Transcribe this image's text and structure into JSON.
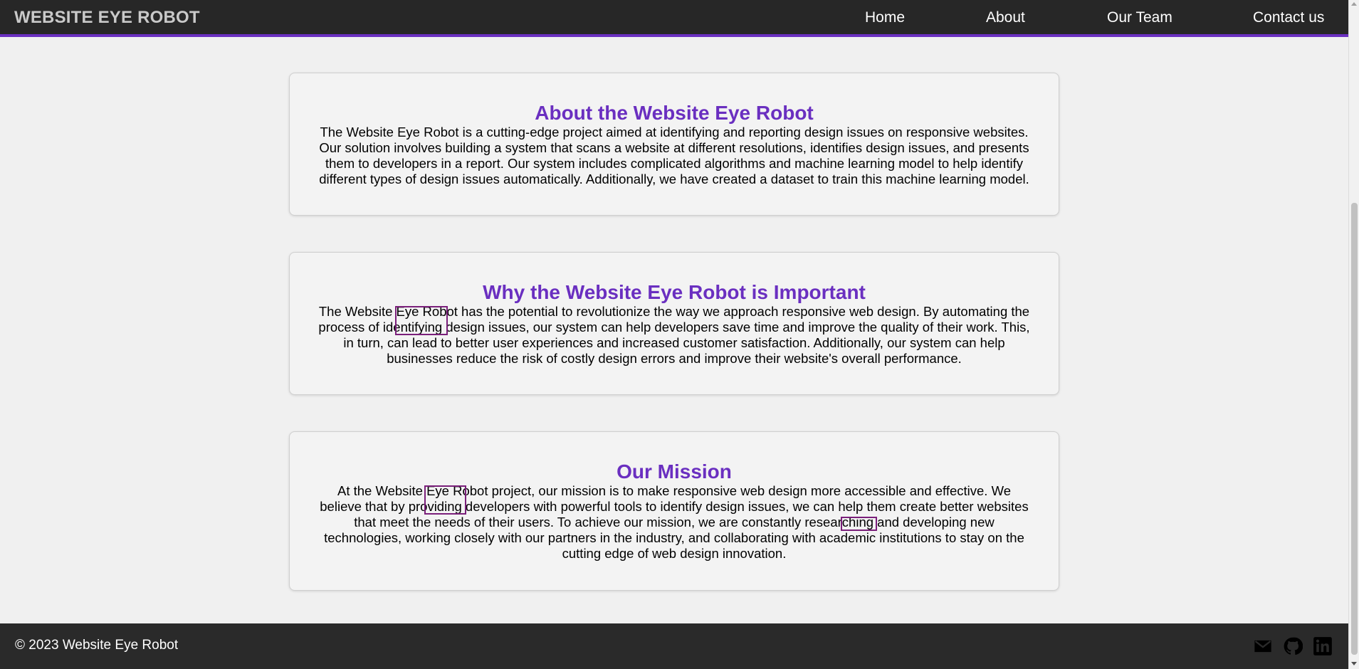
{
  "navbar": {
    "brand": "WEBSITE EYE ROBOT",
    "links": [
      "Home",
      "About",
      "Our Team",
      "Contact us"
    ]
  },
  "sections": [
    {
      "title": "About the Website Eye Robot",
      "text": "The Website Eye Robot is a cutting-edge project aimed at identifying and reporting design issues on responsive websites. Our solution involves building a system that scans a website at different resolutions, identifies design issues, and presents them to developers in a report. Our system includes complicated algorithms and machine learning model to help identify different types of design issues automatically. Additionally, we have created a dataset to train this machine learning model."
    },
    {
      "title": "Why the Website Eye Robot is Important",
      "text": "The Website Eye Robot has the potential to revolutionize the way we approach responsive web design. By automating the process of identifying design issues, our system can help developers save time and improve the quality of their work. This, in turn, can lead to better user experiences and increased customer satisfaction. Additionally, our system can help businesses reduce the risk of costly design errors and improve their website's overall performance."
    },
    {
      "title": "Our Mission",
      "text": "At the Website Eye Robot project, our mission is to make responsive web design more accessible and effective. We believe that by providing developers with powerful tools to identify design issues, we can help them create better websites that meet the needs of their users. To achieve our mission, we are constantly researching and developing new technologies, working closely with our partners in the industry, and collaborating with academic institutions to stay on the cutting edge of web design innovation."
    }
  ],
  "footer": {
    "copyright": "© 2023 Website Eye Robot",
    "icons": [
      "email-icon",
      "github-icon",
      "linkedin-icon"
    ]
  },
  "colors": {
    "accent": "#6a2fc0",
    "highlight_box": "#7a1f7a",
    "navbar_bg": "#272727",
    "footer_bg": "#2a2a2a"
  }
}
